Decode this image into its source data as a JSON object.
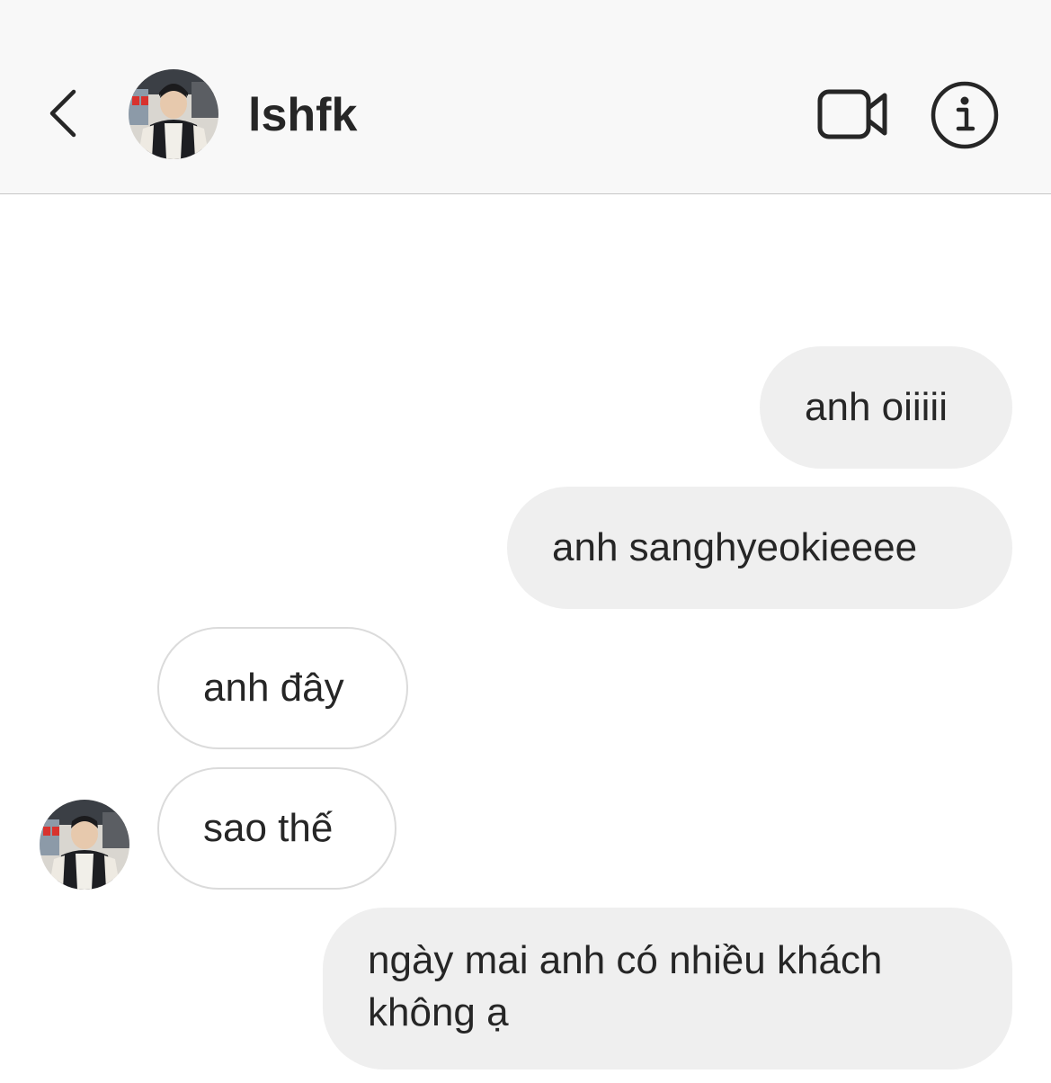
{
  "header": {
    "username": "lshfk",
    "back_icon": "chevron-left-icon",
    "video_icon": "video-camera-icon",
    "info_icon": "info-icon"
  },
  "messages": [
    {
      "from": "me",
      "text": "anh oiiiii"
    },
    {
      "from": "me",
      "text": "anh sanghyeokieeee"
    },
    {
      "from": "them",
      "text": "anh đây"
    },
    {
      "from": "them",
      "text": "sao thế"
    },
    {
      "from": "me",
      "lines": [
        "ngày mai anh có nhiều khách",
        "không ạ"
      ]
    }
  ],
  "colors": {
    "header_bg": "#f8f8f8",
    "sent_bubble": "#efefef",
    "received_border": "#dbdbdb",
    "text": "#262626"
  }
}
